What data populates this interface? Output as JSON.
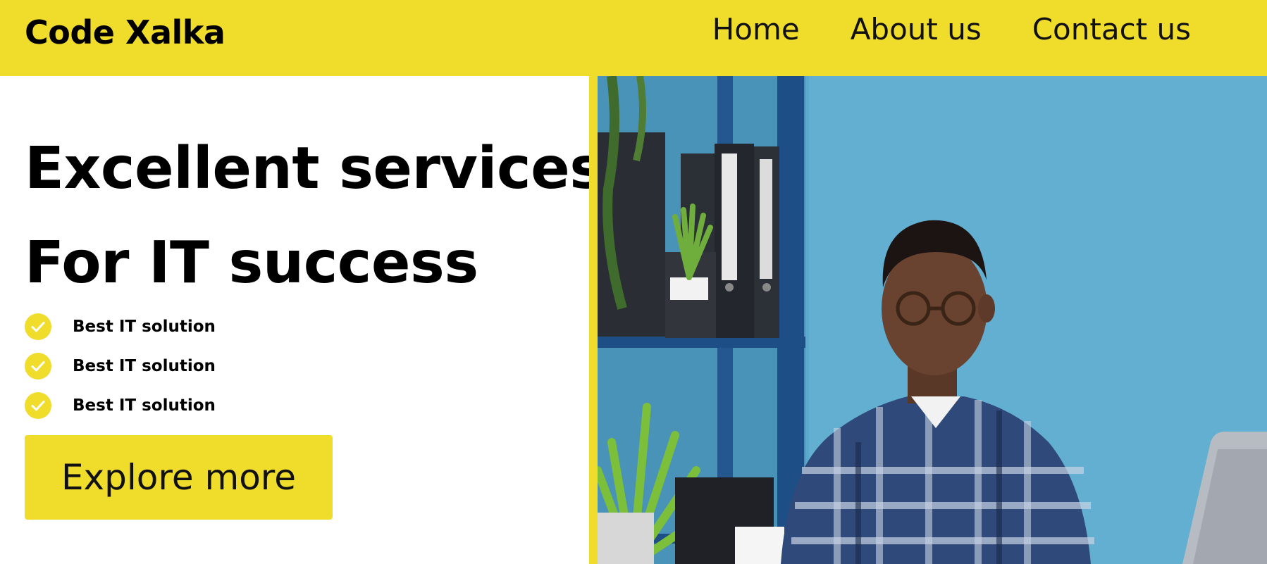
{
  "brand": {
    "name": "Code Xalka"
  },
  "nav": {
    "items": [
      {
        "label": "Home"
      },
      {
        "label": "About us"
      },
      {
        "label": "Contact us"
      }
    ]
  },
  "hero": {
    "headline_line1": "Excellent services",
    "headline_line2": "For IT success",
    "features": [
      {
        "label": "Best IT solution",
        "icon": "check-circle-icon"
      },
      {
        "label": "Best IT solution",
        "icon": "check-circle-icon"
      },
      {
        "label": "Best IT solution",
        "icon": "check-circle-icon"
      }
    ],
    "cta_label": "Explore more",
    "image_icon": "office-photo"
  },
  "colors": {
    "accent": "#f0dc2a",
    "text": "#000000",
    "photo_wall": "#5aa8cc",
    "photo_shelf": "#1d4f86"
  }
}
